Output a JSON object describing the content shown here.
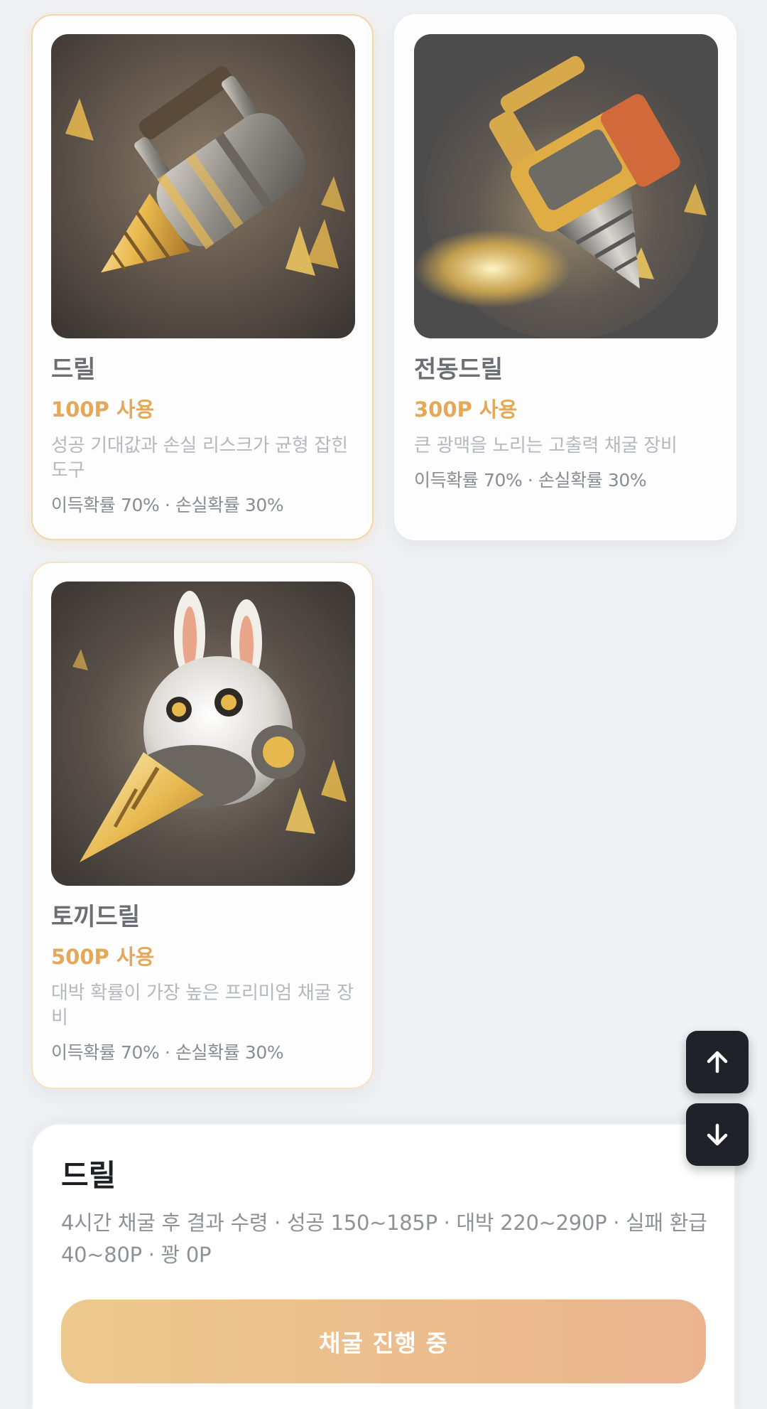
{
  "items": [
    {
      "name": "드릴",
      "cost": "100P 사용",
      "description": "성공 기대값과 손실 리스크가 균형 잡힌 도구",
      "probability": "이득확률 70% · 손실확률 30%",
      "selected": true,
      "image_icon": "drill-image"
    },
    {
      "name": "전동드릴",
      "cost": "300P 사용",
      "description": "큰 광맥을 노리는 고출력 채굴 장비",
      "probability": "이득확률 70% · 손실확률 30%",
      "selected": false,
      "image_icon": "electric-drill-image"
    },
    {
      "name": "토끼드릴",
      "cost": "500P 사용",
      "description": "대박 확률이 가장 높은 프리미엄 채굴 장비",
      "probability": "이득확률 70% · 손실확률 30%",
      "selected": false,
      "image_icon": "rabbit-drill-image"
    }
  ],
  "scroll_controls": {
    "up_icon": "arrow-up-icon",
    "down_icon": "arrow-down-icon"
  },
  "panel": {
    "title": "드릴",
    "description": "4시간 채굴 후 결과 수령 · 성공 150~185P · 대박 220~290P · 실패 환급 40~80P · 꽝 0P",
    "action_label": "채굴 진행 중"
  },
  "colors": {
    "background": "#f0f1f4",
    "accent": "#e3a85a",
    "selected_border": "#f3d7a4",
    "button_gradient_start": "#ecc98c",
    "button_gradient_end": "#ebb48f",
    "scroll_button": "#1f2228"
  }
}
